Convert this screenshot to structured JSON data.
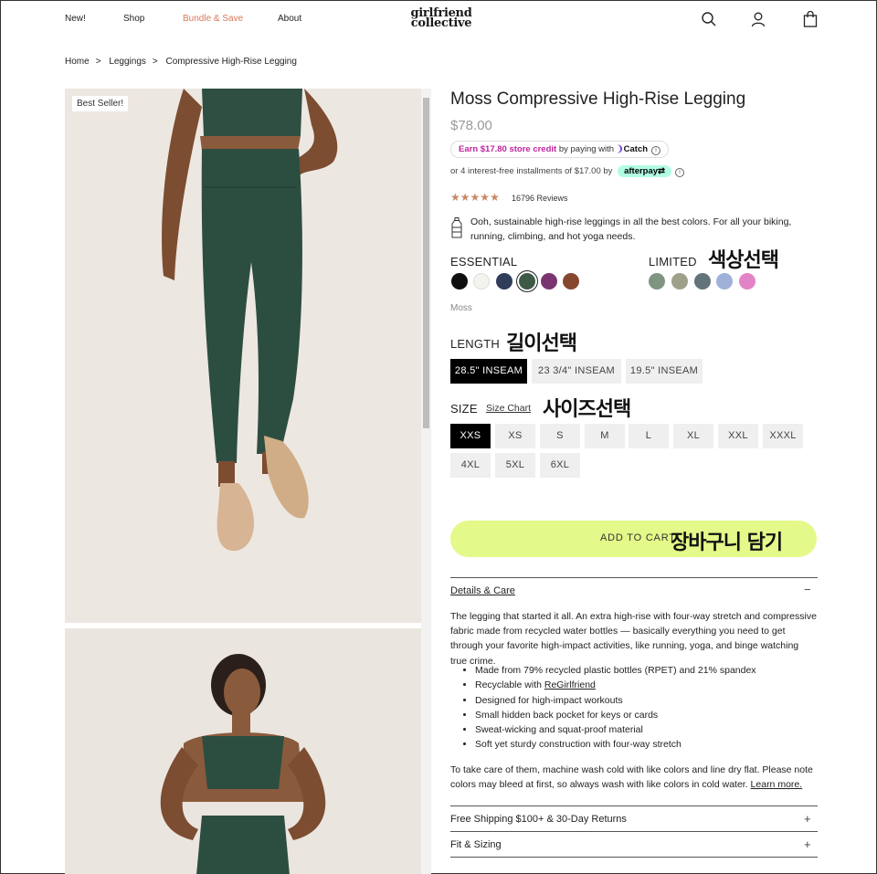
{
  "header": {
    "nav": [
      "New!",
      "Shop",
      "Bundle & Save",
      "About"
    ],
    "logo_line1": "girlfriend",
    "logo_line2": "collective",
    "sale_color": "#d9785a"
  },
  "breadcrumb": [
    "Home",
    "Leggings",
    "Compressive High-Rise Legging"
  ],
  "gallery": {
    "badge": "Best Seller!"
  },
  "product": {
    "title": "Moss Compressive High-Rise Legging",
    "price": "$78.00",
    "catch_earn": "Earn $17.80 store credit",
    "catch_mid": " by paying with ",
    "catch_brand": "Catch",
    "afterpay_text": "or 4 interest-free installments of $17.00 by",
    "afterpay_brand": "afterpay",
    "rating": 5,
    "reviews": "16796 Reviews",
    "short_description": "Ooh, sustainable high-rise leggings in all the best colors. For all your biking, running, climbing, and hot yoga needs."
  },
  "colors": {
    "essential_label": "ESSENTIAL",
    "limited_label": "LIMITED",
    "selected_name": "Moss",
    "essential": [
      "#0f0f0f",
      "#f4f3ee",
      "#2f3c5a",
      "#3e5a47",
      "#7a3570",
      "#87472f"
    ],
    "limited": [
      "#7f9481",
      "#9fa08a",
      "#62747a",
      "#9fb1d9",
      "#e283c6"
    ],
    "annotation": "색상선택"
  },
  "length": {
    "label": "LENGTH",
    "options": [
      "28.5\" INSEAM",
      "23 3/4\" INSEAM",
      "19.5\" INSEAM"
    ],
    "selected": 0,
    "annotation": "길이선택"
  },
  "size": {
    "label": "SIZE",
    "size_chart": "Size Chart",
    "options": [
      "XXS",
      "XS",
      "S",
      "M",
      "L",
      "XL",
      "XXL",
      "XXXL",
      "4XL",
      "5XL",
      "6XL"
    ],
    "selected": 0,
    "annotation": "사이즈선택"
  },
  "cart": {
    "label": "ADD TO CART",
    "annotation": "장바구니 담기",
    "color": "#e3f989"
  },
  "details": {
    "title": "Details & Care",
    "toggle": "−",
    "intro": "The legging that started it all. An extra high-rise with four-way stretch and compressive fabric made from recycled water bottles — basically everything you need to get through your favorite high-impact activities, like running, yoga, and binge watching true crime.",
    "bullets": [
      "Made from 79% recycled plastic bottles (RPET) and 21% spandex",
      "Recyclable with ",
      "Designed for high-impact workouts",
      "Small hidden back pocket for keys or cards",
      "Sweat-wicking and squat-proof material",
      "Soft yet sturdy construction with four-way stretch"
    ],
    "recycle_link": "ReGirlfriend",
    "care": "To take care of them, machine wash cold with like colors and line dry flat. Please note colors may bleed at first, so always wash with like colors in cold water. ",
    "learn_more": "Learn more."
  },
  "accordions": [
    {
      "title": "Free Shipping $100+ & 30-Day Returns",
      "toggle": "+"
    },
    {
      "title": "Fit & Sizing",
      "toggle": "+"
    }
  ]
}
